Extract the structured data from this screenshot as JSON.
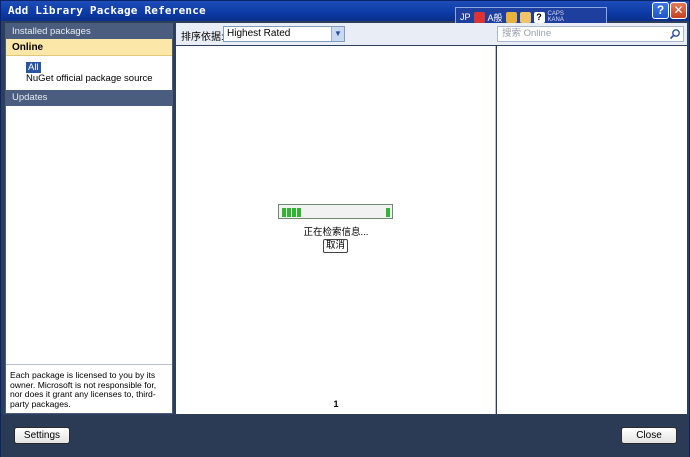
{
  "window": {
    "title": "Add Library Package Reference",
    "help_label": "?",
    "close_label": "✕"
  },
  "ime": {
    "mode": "JP",
    "kanji_label": "A般",
    "help_label": "?",
    "caps_label": "CAPS",
    "kana_label": "KANA"
  },
  "sidebar": {
    "installed_label": "Installed packages",
    "online_label": "Online",
    "all_label": "All",
    "source_label": "NuGet official package source",
    "updates_label": "Updates",
    "license_text": "Each package is licensed to you by its owner. Microsoft is not responsible for, nor does it grant any licenses to, third-party packages."
  },
  "toolbar": {
    "sort_label": "排序依据:",
    "sort_value": "Highest Rated",
    "search_placeholder": "搜索 Online"
  },
  "center": {
    "status_text": "正在检索信息...",
    "cancel_label": "取消",
    "page_number": "1"
  },
  "footer": {
    "settings_label": "Settings",
    "close_label": "Close"
  },
  "colors": {
    "accent": "#2e3f5c",
    "header": "#4a5d7e",
    "selected": "#fbe7a8",
    "progress": "#32b432"
  }
}
